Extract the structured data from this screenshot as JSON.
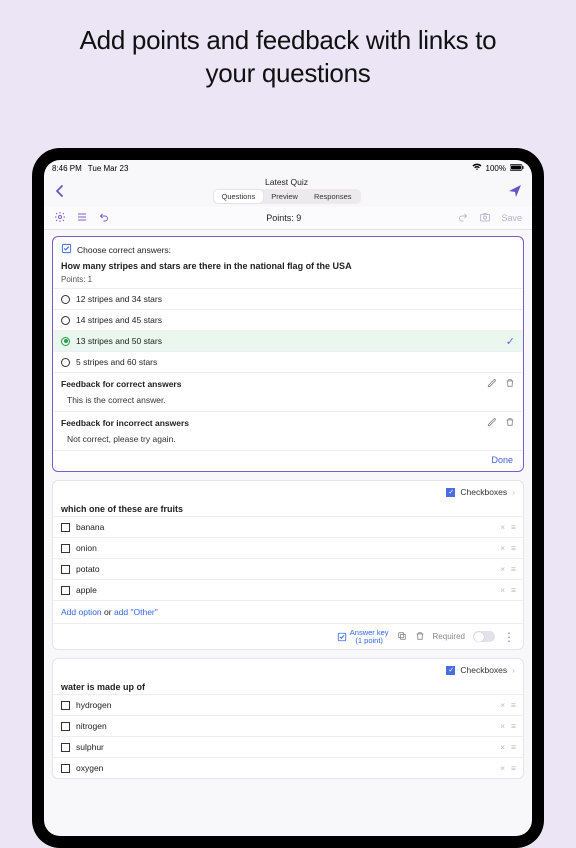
{
  "promo": {
    "title": "Add points and feedback with links to your questions"
  },
  "status": {
    "time": "8:46 PM",
    "date": "Tue Mar 23",
    "wifi": "wifi",
    "battery_pct": "100%"
  },
  "header": {
    "title": "Latest Quiz",
    "tabs": [
      "Questions",
      "Preview",
      "Responses"
    ],
    "active_tab": 0
  },
  "toolbar": {
    "points_label": "Points: 9",
    "save_label": "Save"
  },
  "q1": {
    "choose_label": "Choose correct answers:",
    "question": "How many stripes and stars are there in the national flag of the USA",
    "points_label": "Points: 1",
    "options": [
      "12 stripes and 34 stars",
      "14 stripes and 45 stars",
      "13 stripes and 50 stars",
      "5 stripes and 60 stars"
    ],
    "correct_index": 2,
    "fb_correct_head": "Feedback for correct answers",
    "fb_correct_body": "This is the correct answer.",
    "fb_incorrect_head": "Feedback for incorrect answers",
    "fb_incorrect_body": "Not correct, please try again.",
    "done_label": "Done"
  },
  "q2": {
    "type_label": "Checkboxes",
    "question": "which one of these are fruits",
    "options": [
      "banana",
      "onion",
      "potato",
      "apple"
    ],
    "add_option": "Add option",
    "or_text": " or ",
    "add_other": "add \"Other\"",
    "answer_key_label": "Answer key",
    "answer_key_sub": "(1 point)",
    "required_label": "Required"
  },
  "q3": {
    "type_label": "Checkboxes",
    "question": "water is made up of",
    "options": [
      "hydrogen",
      "nitrogen",
      "sulphur",
      "oxygen"
    ]
  },
  "icons": {
    "remove": "×",
    "grip": "≡",
    "check": "✓",
    "chevron": "›",
    "more": "⋮"
  }
}
